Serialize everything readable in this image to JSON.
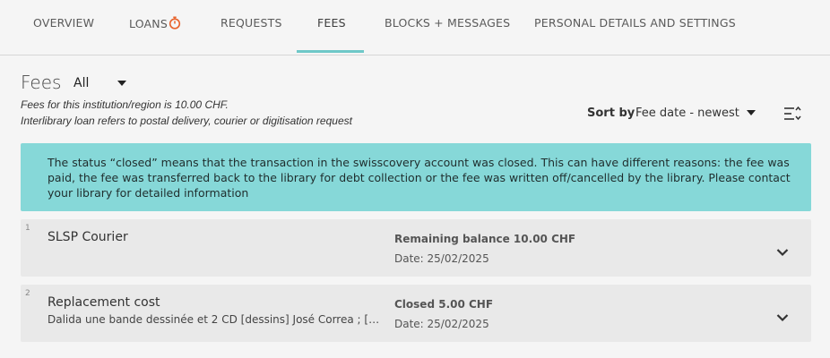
{
  "tabs": [
    {
      "label": "OVERVIEW",
      "active": false
    },
    {
      "label": "LOANS",
      "active": false,
      "icon": "stopwatch-icon",
      "icon_color": "#e8622c"
    },
    {
      "label": "REQUESTS",
      "active": false
    },
    {
      "label": "FEES",
      "active": true
    },
    {
      "label": "BLOCKS + MESSAGES",
      "active": false
    },
    {
      "label": "PERSONAL DETAILS AND SETTINGS",
      "active": false
    }
  ],
  "fees": {
    "title": "Fees",
    "filter_value": "All",
    "note_line1": "Fees for this institution/region is 10.00 CHF.",
    "note_line2": "Interlibrary loan refers to postal delivery, courier or digitisation request"
  },
  "sort": {
    "label": "Sort by",
    "value": "Fee date - newest"
  },
  "banner": {
    "text": "The status “closed” means that the transaction in the swisscovery account was closed. This can have different reasons: the fee was paid, the fee was transferred back to the library for debt collection or the fee was written off/cancelled by the library. Please contact your library for detailed information",
    "color": "#86d8d8"
  },
  "fee_items": [
    {
      "index": "1",
      "title": "SLSP Courier",
      "subtitle": "",
      "status": "Remaining balance 10.00 CHF",
      "date": "Date: 25/02/2025"
    },
    {
      "index": "2",
      "title": "Replacement cost",
      "subtitle": "Dalida une bande dessinée et 2 CD [dessins] José Correa ; [éd. …",
      "status": "Closed 5.00 CHF",
      "date": "Date: 25/02/2025"
    }
  ],
  "colors": {
    "accent": "#6ec8c8",
    "row_bg": "#e9e9e9",
    "page_bg": "#f5f5f5"
  }
}
